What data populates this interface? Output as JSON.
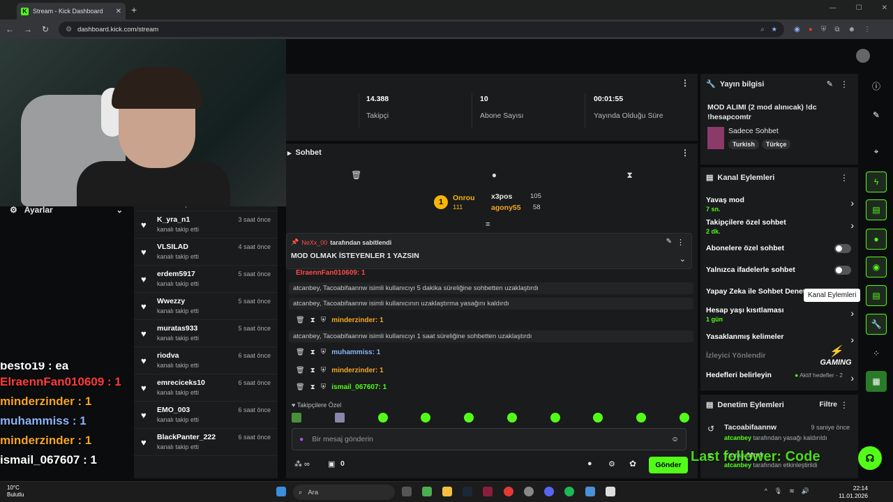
{
  "browser": {
    "tab_title": "Stream - Kick Dashboard",
    "url": "dashboard.kick.com/stream"
  },
  "overlay_chat": [
    {
      "text": "besto19 : ea",
      "color": "#ffffff"
    },
    {
      "text": "ElraennFan010609 : 1",
      "color": "#ff3b3b"
    },
    {
      "text": "minderzinder : 1",
      "color": "#f5a623"
    },
    {
      "text": "muhammiss : 1",
      "color": "#8ab4f8"
    },
    {
      "text": "minderzinder : 1",
      "color": "#f5a623"
    },
    {
      "text": "ismail_067607 : 1",
      "color": "#ffffff"
    }
  ],
  "settings_label": "Ayarlar",
  "followers": [
    {
      "name": "",
      "sub": "kanalı takip etti",
      "time": ""
    },
    {
      "name": "K_yra_n1",
      "sub": "kanalı takip etti",
      "time": "3 saat önce"
    },
    {
      "name": "VLSILAD",
      "sub": "kanalı takip etti",
      "time": "4 saat önce"
    },
    {
      "name": "erdem5917",
      "sub": "kanalı takip etti",
      "time": "5 saat önce"
    },
    {
      "name": "Wwezzy",
      "sub": "kanalı takip etti",
      "time": "5 saat önce"
    },
    {
      "name": "muratas933",
      "sub": "kanalı takip etti",
      "time": "5 saat önce"
    },
    {
      "name": "riodva",
      "sub": "kanalı takip etti",
      "time": "6 saat önce"
    },
    {
      "name": "emreciceks10",
      "sub": "kanalı takip etti",
      "time": "6 saat önce"
    },
    {
      "name": "EMO_003",
      "sub": "kanalı takip etti",
      "time": "6 saat önce"
    },
    {
      "name": "BlackPanter_222",
      "sub": "kanalı takip etti",
      "time": "6 saat önce"
    }
  ],
  "stats": [
    {
      "value": "14.388",
      "label": "Takipçi"
    },
    {
      "value": "10",
      "label": "Abone Sayısı"
    },
    {
      "value": "00:01:55",
      "label": "Yayında Olduğu Süre"
    }
  ],
  "chat": {
    "title": "Sohbet",
    "leaders": {
      "first_name": "Onrou",
      "first_count": "111",
      "second_name": "x3pos",
      "second_count": "105",
      "third_name": "agony55",
      "third_count": "58"
    },
    "pinned": {
      "by": "NeXx_00",
      "by_suffix": "tarafından sabitlendi",
      "message": "MOD OLMAK İSTEYENLER 1 YAZSIN"
    },
    "partial_user": "ElraennFan010609: 1",
    "sys1": "atcanbey, Tacoabifaannw isimli kullanıcıyı 5 dakika süreliğine sohbetten uzaklaştırdı",
    "sys2": "atcanbey, Tacoabifaannw isimli kullanıcının uzaklaştırma yasağını kaldırdı",
    "u1": "minderzinder: 1",
    "sys3": "atcanbey, Tacoabifaannw isimli kullanıcıyı 1 saat süreliğine sohbetten uzaklaştırdı",
    "u2": "muhammiss: 1",
    "u3": "minderzinder: 1",
    "u4": "ismail_067607: 1",
    "followers_only": "Takipçilere Özel",
    "placeholder": "Bir mesaj gönderin",
    "count": "0",
    "send": "Gönder"
  },
  "stream_info": {
    "title": "Yayın bilgisi",
    "stream_title": "MOD ALIMI (2 mod alınıcak) !dc !hesapcomtr",
    "category": "Sadece Sohbet",
    "tags": [
      "Turkish",
      "Türkçe"
    ]
  },
  "channel_actions": {
    "title": "Kanal Eylemleri",
    "items": [
      {
        "label": "Yavaş mod",
        "sub": "7 sn."
      },
      {
        "label": "Takipçilere özel sohbet",
        "sub": "2 dk."
      },
      {
        "label": "Abonelere özel sohbet",
        "sub": ""
      },
      {
        "label": "Yalnızca ifadelerle sohbet",
        "sub": ""
      },
      {
        "label": "Yapay Zeka ile Sohbet Denetimi",
        "sub": ""
      },
      {
        "label": "Hesap yaşı kısıtlaması",
        "sub": "1 gün"
      },
      {
        "label": "Yasaklanmış kelimeler",
        "sub": ""
      },
      {
        "label": "İzleyici Yönlendir",
        "sub": ""
      },
      {
        "label": "Hedefleri belirleyin",
        "sub": "Aktif hedefler - 2"
      }
    ]
  },
  "mod_actions": {
    "title": "Denetim Eylemleri",
    "filter": "Filtre",
    "items": [
      {
        "user": "Tacoabifaannw",
        "time": "9 saniye önce",
        "by": "atcanbey",
        "action": "tarafından yasağı kaldırıldı"
      },
      {
        "user": "Yavaş Mod",
        "time": "",
        "by": "atcanbey",
        "action": "tarafından etkinleştirildi"
      }
    ]
  },
  "tooltip": "Kanal Eylemleri",
  "overlay_last_follower": "Last follower: Code",
  "gaming_logo": "GAMING",
  "taskbar": {
    "weather_temp": "10°C",
    "weather_desc": "Bulutlu",
    "search": "Ara",
    "time": "22:14",
    "date": "11.01.2026"
  }
}
